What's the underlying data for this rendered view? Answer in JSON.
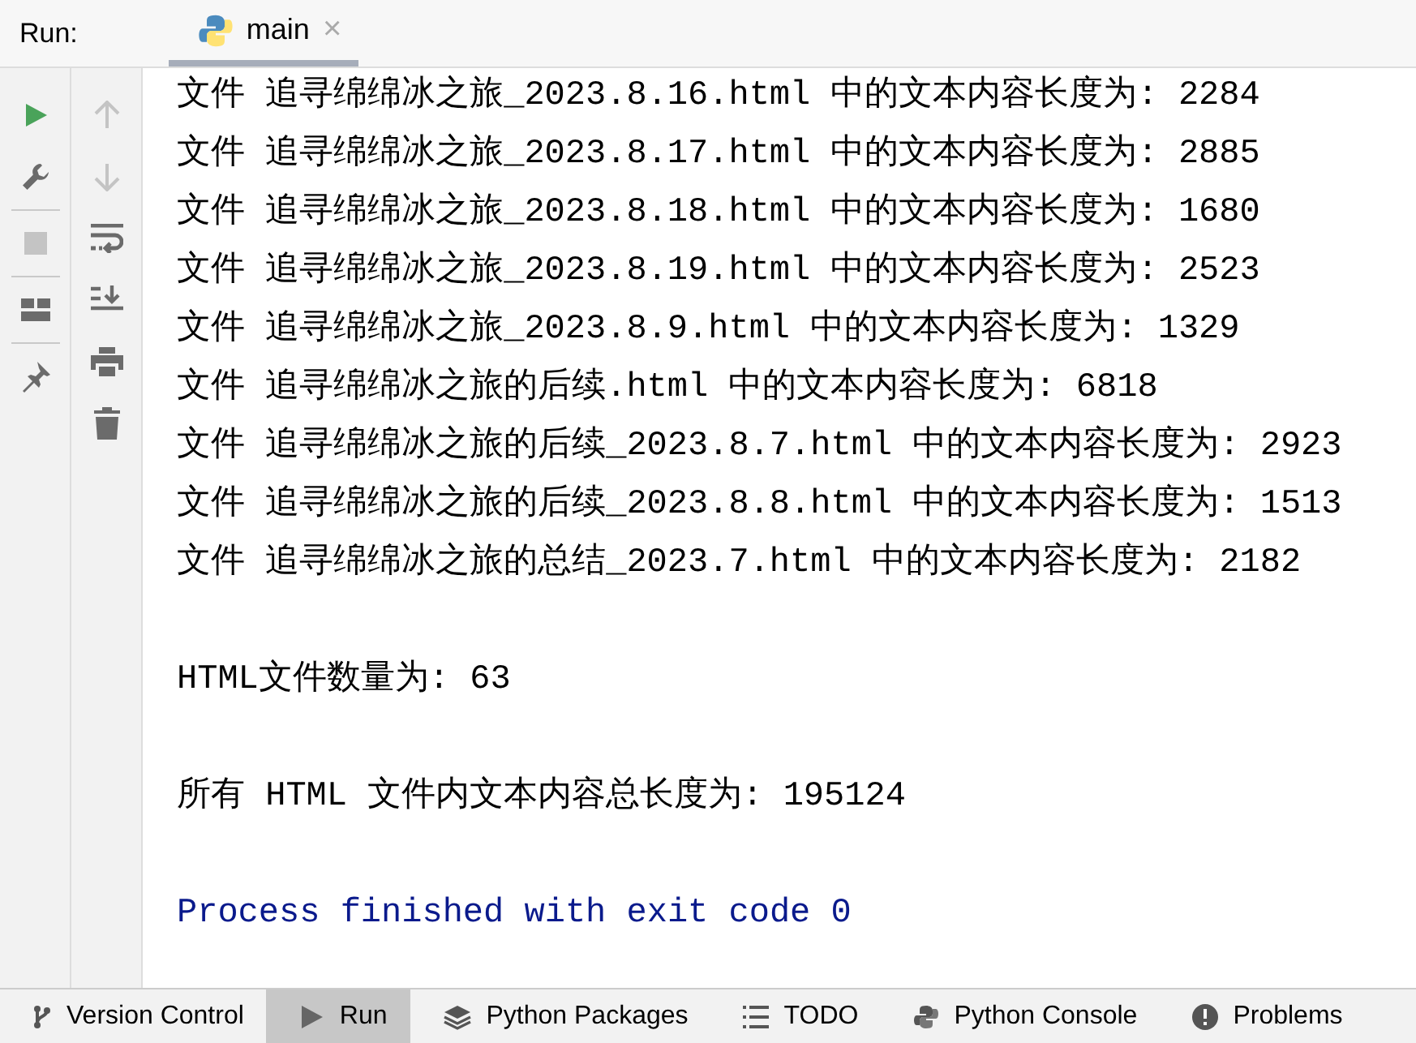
{
  "header": {
    "label": "Run:",
    "tabs": [
      {
        "label": "main",
        "close": "×",
        "selected": true
      }
    ]
  },
  "toolbar_1": [
    {
      "kind": "run",
      "disabled": false
    },
    {
      "kind": "wrench",
      "disabled": false
    },
    {
      "kind": "separator"
    },
    {
      "kind": "stop",
      "disabled": true
    },
    {
      "kind": "separator"
    },
    {
      "kind": "layout",
      "disabled": false
    },
    {
      "kind": "separator"
    },
    {
      "kind": "pin",
      "disabled": false
    }
  ],
  "toolbar_2": [
    {
      "kind": "up",
      "disabled": true
    },
    {
      "kind": "down",
      "disabled": true
    },
    {
      "kind": "wrap",
      "disabled": false
    },
    {
      "kind": "scroll-end",
      "disabled": false
    },
    {
      "kind": "print",
      "disabled": false
    },
    {
      "kind": "trash",
      "disabled": false
    }
  ],
  "console": [
    {
      "kind": "output",
      "text": "文件 追寻绵绵冰之旅_2023.8.16.html 中的文本内容长度为: 2284"
    },
    {
      "kind": "output",
      "text": "文件 追寻绵绵冰之旅_2023.8.17.html 中的文本内容长度为: 2885"
    },
    {
      "kind": "output",
      "text": "文件 追寻绵绵冰之旅_2023.8.18.html 中的文本内容长度为: 1680"
    },
    {
      "kind": "output",
      "text": "文件 追寻绵绵冰之旅_2023.8.19.html 中的文本内容长度为: 2523"
    },
    {
      "kind": "output",
      "text": "文件 追寻绵绵冰之旅_2023.8.9.html 中的文本内容长度为: 1329"
    },
    {
      "kind": "output",
      "text": "文件 追寻绵绵冰之旅的后续.html 中的文本内容长度为: 6818"
    },
    {
      "kind": "output",
      "text": "文件 追寻绵绵冰之旅的后续_2023.8.7.html 中的文本内容长度为: 2923"
    },
    {
      "kind": "output",
      "text": "文件 追寻绵绵冰之旅的后续_2023.8.8.html 中的文本内容长度为: 1513"
    },
    {
      "kind": "output",
      "text": "文件 追寻绵绵冰之旅的总结_2023.7.html 中的文本内容长度为: 2182"
    },
    {
      "kind": "blank"
    },
    {
      "kind": "output",
      "text": "HTML文件数量为: 63"
    },
    {
      "kind": "blank"
    },
    {
      "kind": "output",
      "text": "所有 HTML 文件内文本内容总长度为: 195124"
    },
    {
      "kind": "blank"
    },
    {
      "kind": "exit",
      "text": "Process finished with exit code 0"
    }
  ],
  "bottom_tabs": [
    {
      "kind": "branch",
      "label": "Version Control",
      "selected": false
    },
    {
      "kind": "run",
      "label": "Run",
      "selected": true
    },
    {
      "kind": "layers",
      "label": "Python Packages",
      "selected": false
    },
    {
      "kind": "list",
      "label": "TODO",
      "selected": false
    },
    {
      "kind": "python",
      "label": "Python Console",
      "selected": false
    },
    {
      "kind": "alert",
      "label": "Problems",
      "selected": false
    }
  ]
}
